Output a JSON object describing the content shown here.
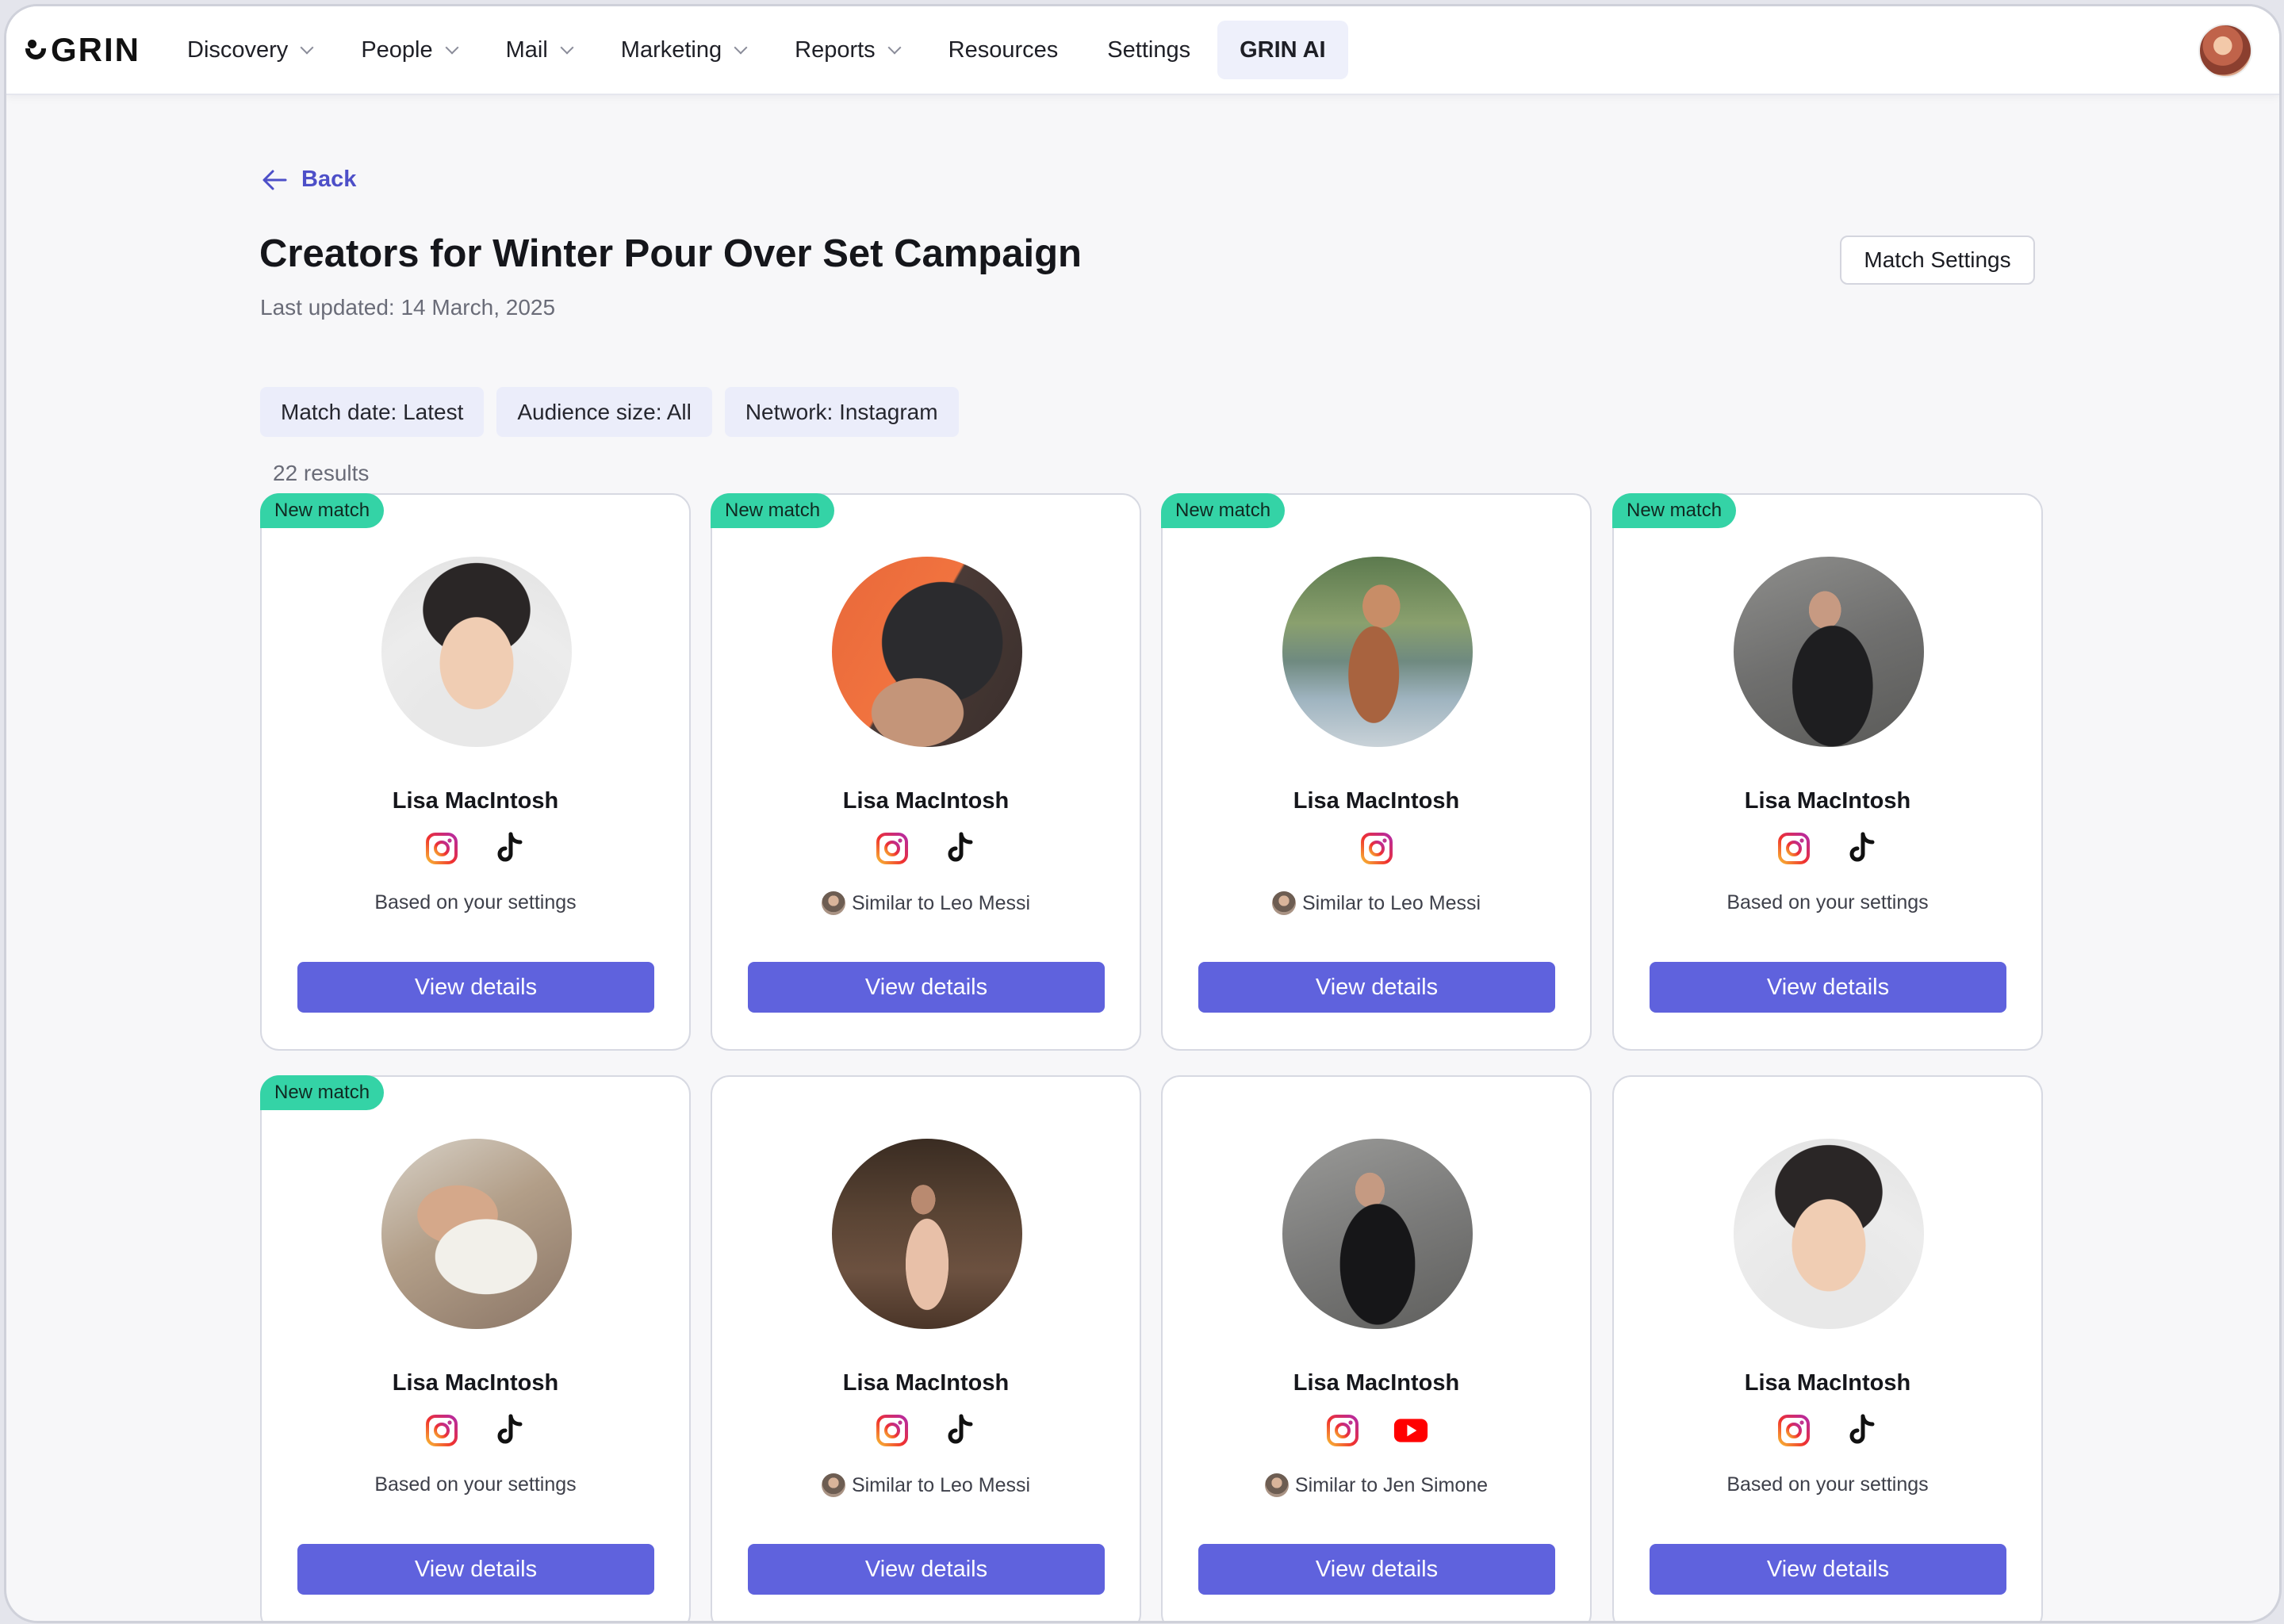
{
  "app": {
    "logo_text": "GRIN"
  },
  "nav": {
    "items": [
      {
        "label": "Discovery",
        "has_menu": true
      },
      {
        "label": "People",
        "has_menu": true
      },
      {
        "label": "Mail",
        "has_menu": true
      },
      {
        "label": "Marketing",
        "has_menu": true
      },
      {
        "label": "Reports",
        "has_menu": true
      },
      {
        "label": "Resources",
        "has_menu": false
      },
      {
        "label": "Settings",
        "has_menu": false
      },
      {
        "label": "GRIN AI",
        "has_menu": false,
        "active": true
      }
    ]
  },
  "header": {
    "back_label": "Back",
    "title": "Creators for Winter Pour Over Set Campaign",
    "last_updated": "Last updated: 14 March, 2025",
    "match_settings_label": "Match Settings"
  },
  "filters": [
    {
      "label": "Match date: Latest"
    },
    {
      "label": "Audience size: All"
    },
    {
      "label": "Network: Instagram"
    }
  ],
  "results_text": "22 results",
  "colors": {
    "accent": "#5f62dd",
    "new_match_badge": "#34d3a6",
    "chip_bg": "#ebedfa",
    "back_link": "#4d4fc8"
  },
  "cards": [
    {
      "badge": "New match",
      "name": "Lisa MacIntosh",
      "networks": [
        "instagram-icon",
        "tiktok-icon"
      ],
      "reason": "Based on your settings",
      "reason_avatar": false,
      "button": "View details"
    },
    {
      "badge": "New match",
      "name": "Lisa MacIntosh",
      "networks": [
        "instagram-icon",
        "tiktok-icon"
      ],
      "reason": "Similar to Leo Messi",
      "reason_avatar": true,
      "button": "View details"
    },
    {
      "badge": "New match",
      "name": "Lisa MacIntosh",
      "networks": [
        "instagram-icon"
      ],
      "reason": "Similar to Leo Messi",
      "reason_avatar": true,
      "button": "View details"
    },
    {
      "badge": "New match",
      "name": "Lisa MacIntosh",
      "networks": [
        "instagram-icon",
        "tiktok-icon"
      ],
      "reason": "Based on your settings",
      "reason_avatar": false,
      "button": "View details"
    },
    {
      "badge": "New match",
      "name": "Lisa MacIntosh",
      "networks": [
        "instagram-icon",
        "tiktok-icon"
      ],
      "reason": "Based on your settings",
      "reason_avatar": false,
      "button": "View details"
    },
    {
      "badge": "",
      "name": "Lisa MacIntosh",
      "networks": [
        "instagram-icon",
        "tiktok-icon"
      ],
      "reason": "Similar to Leo Messi",
      "reason_avatar": true,
      "button": "View details"
    },
    {
      "badge": "",
      "name": "Lisa MacIntosh",
      "networks": [
        "instagram-icon",
        "youtube-icon"
      ],
      "reason": "Similar to Jen Simone",
      "reason_avatar": true,
      "button": "View details"
    },
    {
      "badge": "",
      "name": "Lisa MacIntosh",
      "networks": [
        "instagram-icon",
        "tiktok-icon"
      ],
      "reason": "Based on your settings",
      "reason_avatar": false,
      "button": "View details"
    }
  ]
}
